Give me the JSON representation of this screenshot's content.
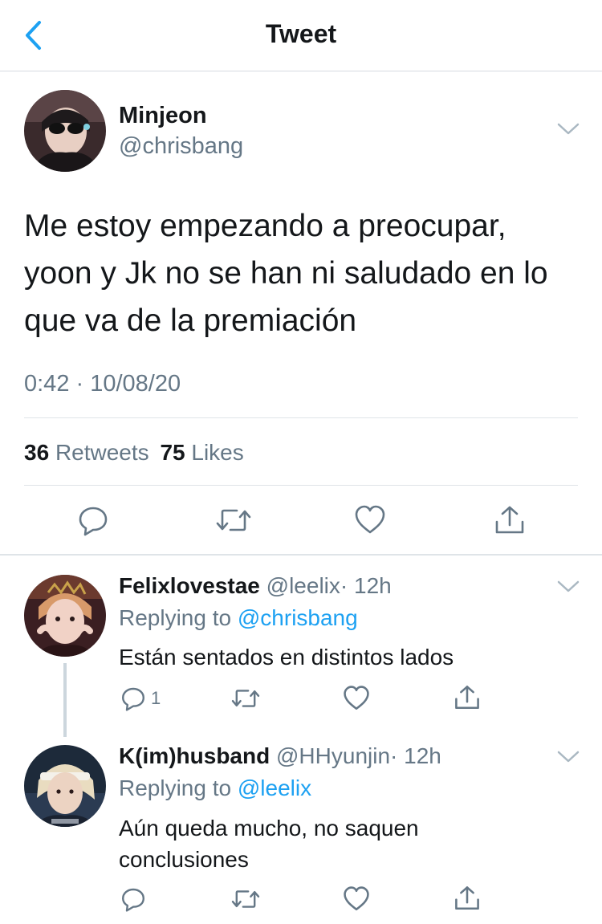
{
  "header": {
    "title": "Tweet"
  },
  "tweet": {
    "display_name": "Minjeon",
    "handle": "@chrisbang",
    "text_lines": [
      "Me estoy empezando a preocupar,",
      "yoon y Jk no se han ni saludado en lo",
      "que va de la premiación"
    ],
    "timestamp": "0:42 · 10/08/20",
    "retweets_count": "36",
    "retweets_label": "Retweets",
    "likes_count": "75",
    "likes_label": "Likes"
  },
  "replies": [
    {
      "display_name": "Felixlovestae",
      "handle": "@leelix",
      "time": "· 12h",
      "replying_label": "Replying to",
      "replying_to": "@chrisbang",
      "text_lines": [
        "Están sentados en distintos lados"
      ],
      "reply_count": "1"
    },
    {
      "display_name": "K(im)husband",
      "handle": "@HHyunjin",
      "time": "· 12h",
      "replying_label": "Replying to",
      "replying_to": "@leelix",
      "text_lines": [
        "Aún queda mucho, no saquen",
        "conclusiones"
      ],
      "reply_count": ""
    }
  ],
  "icons": {
    "back": "chevron-left-icon",
    "menu": "chevron-down-icon",
    "reply": "comment-icon",
    "retweet": "retweet-icon",
    "like": "heart-icon",
    "share": "share-icon"
  },
  "colors": {
    "accent": "#1da1f2",
    "text": "#14171a",
    "muted": "#657786",
    "divider": "#dfe4e8"
  }
}
